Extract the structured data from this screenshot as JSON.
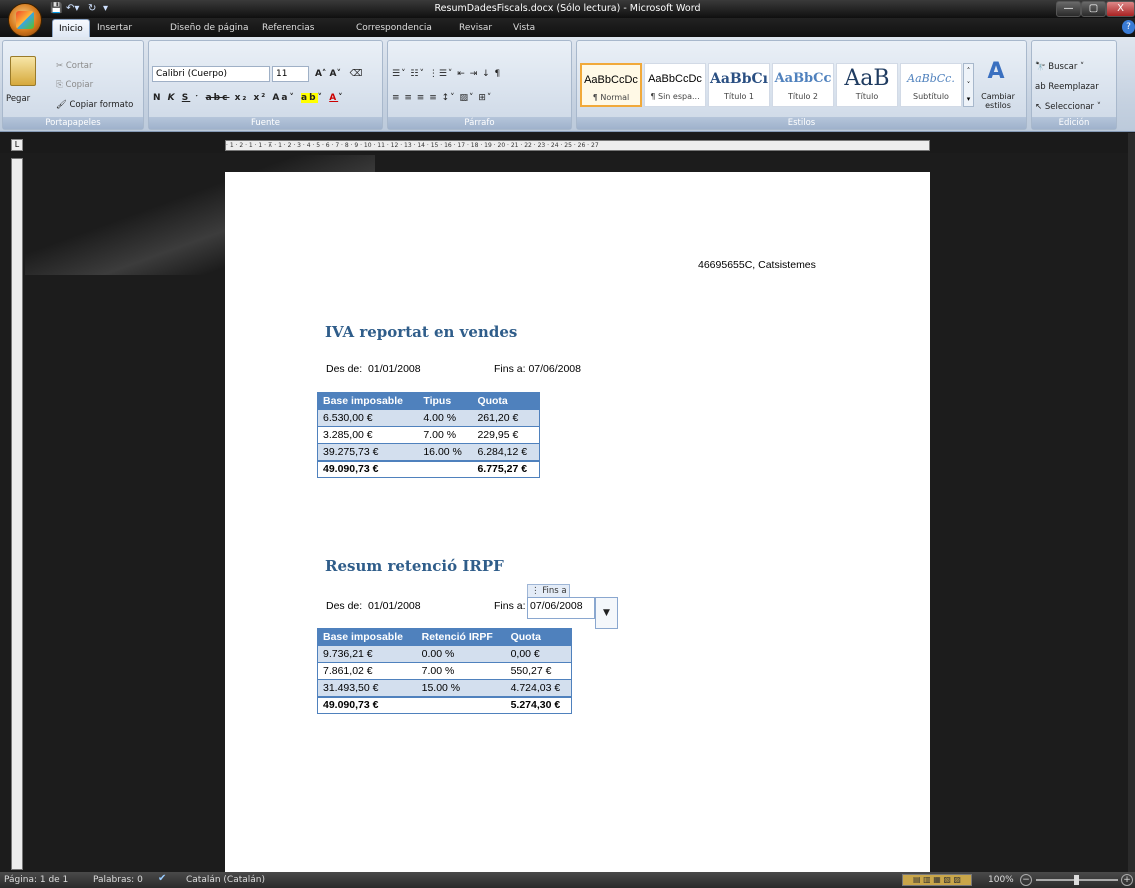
{
  "window": {
    "title": "ResumDadesFiscals.docx (Sólo lectura) - Microsoft Word",
    "minimize": "—",
    "maximize": "▢",
    "close": "X"
  },
  "tabs": [
    "Inicio",
    "Insertar",
    "Diseño de página",
    "Referencias",
    "Correspondencia",
    "Revisar",
    "Vista"
  ],
  "ribbon": {
    "clipboard": {
      "label": "Portapapeles",
      "paste": "Pegar",
      "cut": "Cortar",
      "copy": "Copiar",
      "format_painter": "Copiar formato"
    },
    "font": {
      "label": "Fuente",
      "font_name": "Calibri (Cuerpo)",
      "font_size": "11"
    },
    "paragraph": {
      "label": "Párrafo"
    },
    "styles": {
      "label": "Estilos",
      "items": [
        {
          "preview": "AaBbCcDc",
          "name": "¶ Normal"
        },
        {
          "preview": "AaBbCcDc",
          "name": "¶ Sin espa..."
        },
        {
          "preview": "AaBbCı",
          "name": "Título 1"
        },
        {
          "preview": "AaBbCc",
          "name": "Título 2"
        },
        {
          "preview": "AaB",
          "name": "Título"
        },
        {
          "preview": "AaBbCc.",
          "name": "Subtítulo"
        }
      ],
      "change_styles": "Cambiar estilos"
    },
    "editing": {
      "label": "Edición",
      "find": "Buscar",
      "replace": "Reemplazar",
      "select": "Seleccionar"
    }
  },
  "document": {
    "header_right": "46695655C, Catsistemes",
    "section1": {
      "title": "IVA reportat en vendes",
      "from_label": "Des de:",
      "from_date": "01/01/2008",
      "to_label": "Fins a:",
      "to_date": "07/06/2008",
      "headers": [
        "Base imposable",
        "Tipus",
        "Quota"
      ],
      "rows": [
        [
          "6.530,00 €",
          "4.00 %",
          "261,20 €"
        ],
        [
          "3.285,00 €",
          "7.00 %",
          "229,95 €"
        ],
        [
          "39.275,73 €",
          "16.00 %",
          "6.284,12 €"
        ]
      ],
      "total": [
        "49.090,73 €",
        "",
        "6.775,27 €"
      ]
    },
    "section2": {
      "title": "Resum retenció IRPF",
      "from_label": "Des de:",
      "from_date": "01/01/2008",
      "to_label": "Fins a:",
      "to_date": "07/06/2008",
      "control_tag": "Fins a",
      "headers": [
        "Base imposable",
        "Retenció IRPF",
        "Quota"
      ],
      "rows": [
        [
          "9.736,21 €",
          "0.00 %",
          "0,00 €"
        ],
        [
          "7.861,02 €",
          "7.00 %",
          "550,27 €"
        ],
        [
          "31.493,50 €",
          "15.00 %",
          "4.724,03 €"
        ]
      ],
      "total": [
        "49.090,73 €",
        "",
        "5.274,30 €"
      ]
    }
  },
  "statusbar": {
    "page": "Página: 1 de 1",
    "words": "Palabras: 0",
    "language": "Catalán (Catalán)",
    "zoom": "100%"
  }
}
